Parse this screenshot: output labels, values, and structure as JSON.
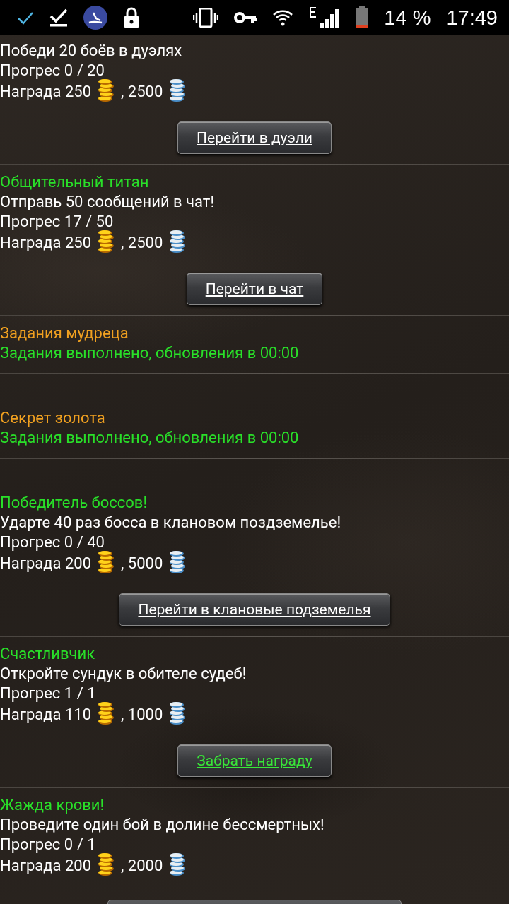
{
  "status_bar": {
    "battery": "14 %",
    "time": "17:49"
  },
  "sections": [
    {
      "kind": "quest",
      "description": "Победи 20 боёв в дуэлях",
      "progress": "Прогрес 0 / 20",
      "reward_label": "Награда 250",
      "reward_silver": ", 2500",
      "button": {
        "label": "Перейти в дуэли",
        "claimable": false
      }
    },
    {
      "kind": "quest",
      "title": "Общительный титан",
      "description": "Отправь 50 сообщений в чат!",
      "progress": "Прогрес 17 / 50",
      "reward_label": "Награда 250",
      "reward_silver": ", 2500",
      "button": {
        "label": "Перейти в чат",
        "claimable": false
      }
    },
    {
      "kind": "info",
      "title": "Задания мудреца",
      "status": "Задания выполнено, обновления в 00:00"
    },
    {
      "kind": "info",
      "title": "Секрет золота",
      "status": "Задания выполнено, обновления в 00:00"
    },
    {
      "kind": "quest",
      "title": "Победитель боссов!",
      "description": "Ударте 40 раз босса в клановом поздземелье!",
      "progress": "Прогрес 0 / 40",
      "reward_label": "Награда 200",
      "reward_silver": ", 5000",
      "button": {
        "label": "Перейти в клановые подземелья",
        "claimable": false
      }
    },
    {
      "kind": "quest",
      "title": "Счастливчик",
      "description": "Откройте сундук в обителе судеб!",
      "progress": "Прогрес 1 / 1",
      "reward_label": "Награда 110",
      "reward_silver": ", 1000",
      "button": {
        "label": "Забрать награду",
        "claimable": true
      }
    },
    {
      "kind": "quest",
      "title": "Жажда крови!",
      "description": "Проведите один бой в долине бессмертных!",
      "progress": "Прогрес 0 / 1",
      "reward_label": "Награда 200",
      "reward_silver": ", 2000",
      "cut_button": true
    }
  ]
}
